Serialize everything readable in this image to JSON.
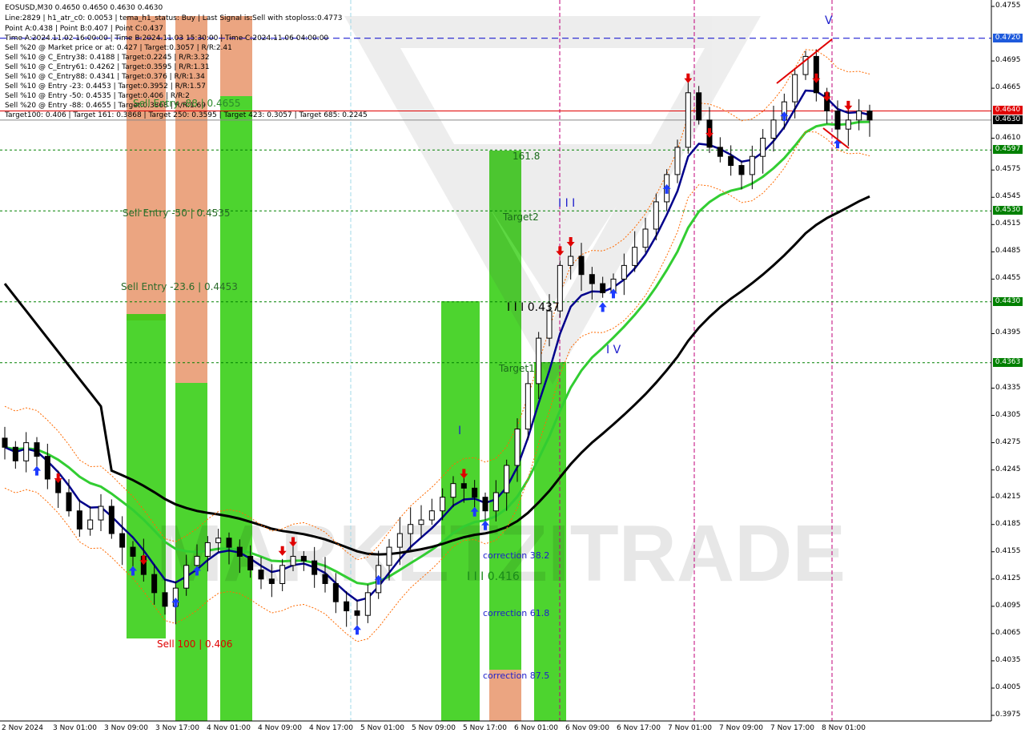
{
  "header": {
    "symbol_line": "EOSUSD,M30  0.4650 0.4650 0.4630 0.4630",
    "lines": [
      "Line:2829  |  h1_atr_c0: 0.0053  |  tema_h1_status: Buy  |  Last Signal is:Sell with stoploss:0.4773",
      "Point A:0.438  |  Point B:0.407  |  Point C:0.437",
      "Time A:2024.11.02 16:00:00  |  Time B:2024.11.03 15:30:00  |  Time C:2024.11.06 04:00:00",
      "Sell %20 @ Market price or at: 0.427  |  Target:0.3057  |  R/R:2.41",
      "Sell %10 @ C_Entry38: 0.4188  |  Target:0.2245  |  R/R:3.32",
      "Sell %10 @ C_Entry61: 0.4262  |  Target:0.3595  |  R/R:1.31",
      "Sell %10 @ C_Entry88: 0.4341  |  Target:0.376  |  R/R:1.34",
      "Sell %10 @ Entry -23: 0.4453  |  Target:0.3952  |  R/R:1.57",
      "Sell %10 @ Entry -50: 0.4535  |  Target:0.406  |  R/R:2",
      "Sell %20 @ Entry -88: 0.4655  |  Target:0.3868  |  R/R:1.69",
      "Target100: 0.406  |  Target 161: 0.3868  |  Target 250: 0.3595  |  Target 423: 0.3057  |  Target 685: 0.2245"
    ]
  },
  "watermark": "MARKETZITRADE",
  "zone_labels": {
    "sell_entry_88": "Sell Entry -88 | 0.4655",
    "sell_entry_50": "Sell Entry -50 | 0.4535",
    "sell_entry_23": "Sell Entry -23.6 | 0.4453",
    "sell_100": "Sell 100 | 0.406",
    "fib_161": "161.8",
    "target2": "Target2",
    "target1": "Target1",
    "corr_38": "correction 38.2",
    "corr_61": "correction 61.8",
    "corr_87": "correction 87.5",
    "point_c": "I I I 0.437",
    "point_b": "I I I 0.416",
    "wave_iii": "I I I",
    "wave_iv": "I V",
    "wave_v": "V",
    "wave_i": "I"
  },
  "colors": {
    "candle": "#000000",
    "ema_fast": "#00008B",
    "ema_mid": "#32CD32",
    "ema_slow": "#000000",
    "zone_green": "#2ECC0A",
    "zone_orange": "#E8956B",
    "red_line": "#E00000",
    "blue_dash": "#0000CC",
    "green_dash": "#008000",
    "session_line": "#C0007A"
  },
  "chart_data": {
    "type": "candlestick",
    "symbol": "EOSUSD",
    "timeframe": "M30",
    "ylim": [
      0.3975,
      0.4755
    ],
    "y_ticks": [
      "0.4755",
      "0.4720",
      "0.4695",
      "0.4665",
      "0.4640",
      "0.4610",
      "0.4575",
      "0.4545",
      "0.4515",
      "0.4485",
      "0.4455",
      "0.4425",
      "0.4395",
      "0.4365",
      "0.4335",
      "0.4305",
      "0.4275",
      "0.4245",
      "0.4215",
      "0.4185",
      "0.4155",
      "0.4125",
      "0.4095",
      "0.4065",
      "0.4035",
      "0.4005",
      "0.3975"
    ],
    "x_labels": [
      "2 Nov 2024",
      "3 Nov 01:00",
      "3 Nov 09:00",
      "3 Nov 17:00",
      "4 Nov 01:00",
      "4 Nov 09:00",
      "4 Nov 17:00",
      "5 Nov 01:00",
      "5 Nov 09:00",
      "5 Nov 17:00",
      "6 Nov 01:00",
      "6 Nov 09:00",
      "6 Nov 17:00",
      "7 Nov 01:00",
      "7 Nov 09:00",
      "7 Nov 17:00",
      "8 Nov 01:00"
    ],
    "levels": [
      {
        "price": 0.472,
        "label": "0.4720",
        "style": "blue-dash"
      },
      {
        "price": 0.464,
        "label": "0.4640",
        "style": "red"
      },
      {
        "price": 0.463,
        "label": "0.4630",
        "style": "current"
      },
      {
        "price": 0.4597,
        "label": "0.4597",
        "style": "green-dash"
      },
      {
        "price": 0.453,
        "label": "0.4530",
        "style": "green-dash"
      },
      {
        "price": 0.443,
        "label": "0.4430",
        "style": "green-dash"
      },
      {
        "price": 0.4363,
        "label": "0.4363",
        "style": "green-dash"
      }
    ],
    "series": [
      {
        "name": "EOSUSD close",
        "values": [
          0.427,
          0.4255,
          0.4275,
          0.426,
          0.4235,
          0.422,
          0.42,
          0.418,
          0.419,
          0.4205,
          0.4175,
          0.416,
          0.415,
          0.413,
          0.411,
          0.4095,
          0.4115,
          0.414,
          0.415,
          0.4165,
          0.417,
          0.416,
          0.415,
          0.4135,
          0.4125,
          0.412,
          0.414,
          0.415,
          0.4145,
          0.413,
          0.412,
          0.41,
          0.409,
          0.4085,
          0.411,
          0.414,
          0.416,
          0.4175,
          0.4185,
          0.419,
          0.42,
          0.4215,
          0.423,
          0.4225,
          0.4215,
          0.42,
          0.422,
          0.425,
          0.429,
          0.434,
          0.439,
          0.442,
          0.447,
          0.448,
          0.446,
          0.445,
          0.444,
          0.4455,
          0.447,
          0.449,
          0.451,
          0.454,
          0.457,
          0.46,
          0.466,
          0.463,
          0.46,
          0.459,
          0.458,
          0.457,
          0.459,
          0.461,
          0.463,
          0.465,
          0.468,
          0.47,
          0.466,
          0.464,
          0.462,
          0.463,
          0.464,
          0.463
        ]
      }
    ]
  }
}
